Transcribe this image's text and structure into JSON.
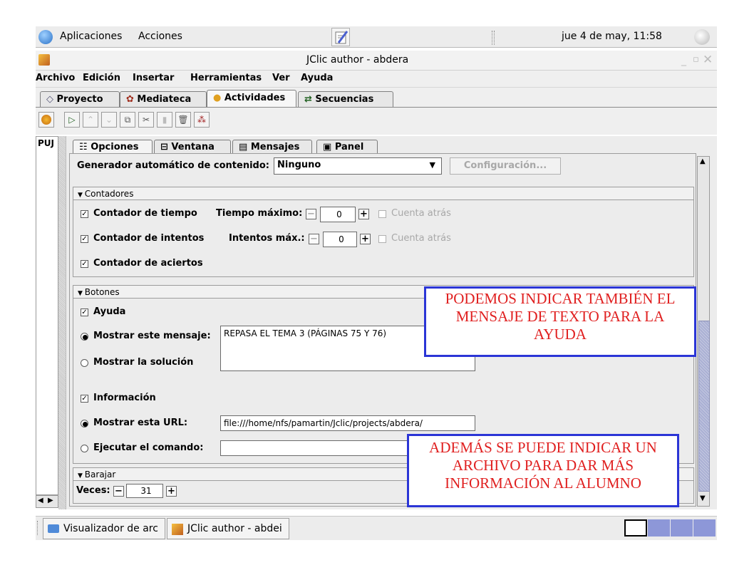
{
  "top_panel": {
    "applications": "Aplicaciones",
    "actions": "Acciones",
    "clock": "jue  4 de may, 11:58"
  },
  "window": {
    "title": "JClic author - abdera"
  },
  "menu": [
    "Archivo",
    "Edición",
    "Insertar",
    "Herramientas",
    "Ver",
    "Ayuda"
  ],
  "main_tabs": [
    "Proyecto",
    "Mediateca",
    "Actividades",
    "Secuencias"
  ],
  "left_list": {
    "item": "PUJ"
  },
  "sub_tabs": [
    "Opciones",
    "Ventana",
    "Mensajes",
    "Panel"
  ],
  "generator": {
    "label": "Generador automático de contenido:",
    "value": "Ninguno",
    "config_button": "Configuración..."
  },
  "counters": {
    "header": "Contadores",
    "time_counter": "Contador de tiempo",
    "max_time_label": "Tiempo máximo:",
    "max_time_value": "0",
    "countdown": "Cuenta atrás",
    "attempts_counter": "Contador de intentos",
    "max_attempts_label": "Intentos máx.:",
    "max_attempts_value": "0",
    "countdown2": "Cuenta atrás",
    "hits_counter": "Contador de aciertos"
  },
  "buttons": {
    "header": "Botones",
    "help": "Ayuda",
    "show_message": "Mostrar este mensaje:",
    "message_text": "REPASA EL TEMA 3 (PÁGINAS 75 Y 76)",
    "show_solution": "Mostrar la solución",
    "info": "Información",
    "show_url": "Mostrar esta URL:",
    "url_value": "file:///home/nfs/pamartin/Jclic/projects/abdera/",
    "run_command": "Ejecutar el comando:"
  },
  "shuffle": {
    "header": "Barajar",
    "times_label": "Veces:",
    "times_value": "31"
  },
  "notes": {
    "note1": "PODEMOS INDICAR TAMBIÉN EL MENSAJE DE TEXTO PARA LA AYUDA",
    "note2": "ADEMÁS SE PUEDE INDICAR UN ARCHIVO PARA DAR MÁS INFORMACIÓN AL ALUMNO"
  },
  "taskbar": {
    "task1": "Visualizador de arc",
    "task2": "JClic author - abdei"
  },
  "colors": {
    "note_border": "#2b35d6",
    "note_text": "#e02020"
  }
}
